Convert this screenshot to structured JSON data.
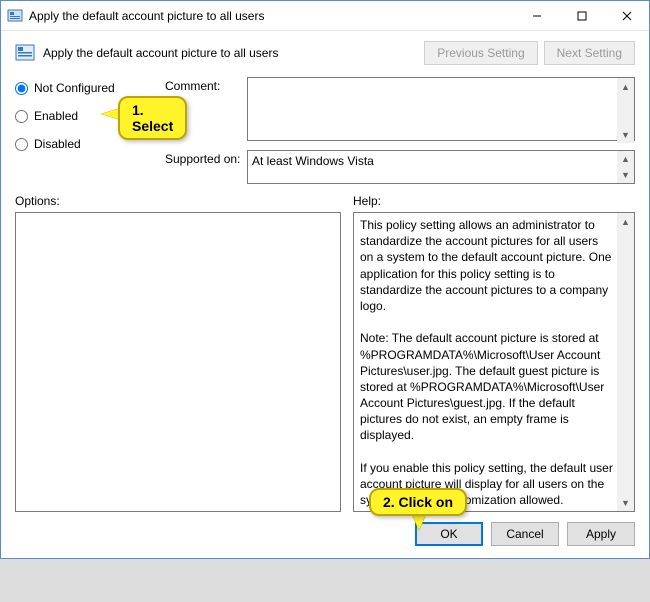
{
  "window": {
    "title": "Apply the default account picture to all users"
  },
  "header": {
    "title": "Apply the default account picture to all users",
    "prev_btn": "Previous Setting",
    "next_btn": "Next Setting"
  },
  "radios": {
    "not_configured": "Not Configured",
    "enabled": "Enabled",
    "disabled": "Disabled",
    "selected": "not_configured"
  },
  "labels": {
    "comment": "Comment:",
    "supported": "Supported on:",
    "options": "Options:",
    "help": "Help:"
  },
  "fields": {
    "comment_value": "",
    "supported_value": "At least Windows Vista"
  },
  "help_text": "This policy setting allows an administrator to standardize the account pictures for all users on a system to the default account picture. One application for this policy setting is to standardize the account pictures to a company logo.\n\nNote: The default account picture is stored at %PROGRAMDATA%\\Microsoft\\User Account Pictures\\user.jpg. The default guest picture is stored at %PROGRAMDATA%\\Microsoft\\User Account Pictures\\guest.jpg. If the default pictures do not exist, an empty frame is displayed.\n\nIf you enable this policy setting, the default user account picture will display for all users on the system with no customization allowed.\n\nIf you disable or do not configure this policy setting, users will be able to customize their account pictures.",
  "buttons": {
    "ok": "OK",
    "cancel": "Cancel",
    "apply": "Apply"
  },
  "callouts": {
    "c1": "1. Select",
    "c2": "2. Click on"
  }
}
